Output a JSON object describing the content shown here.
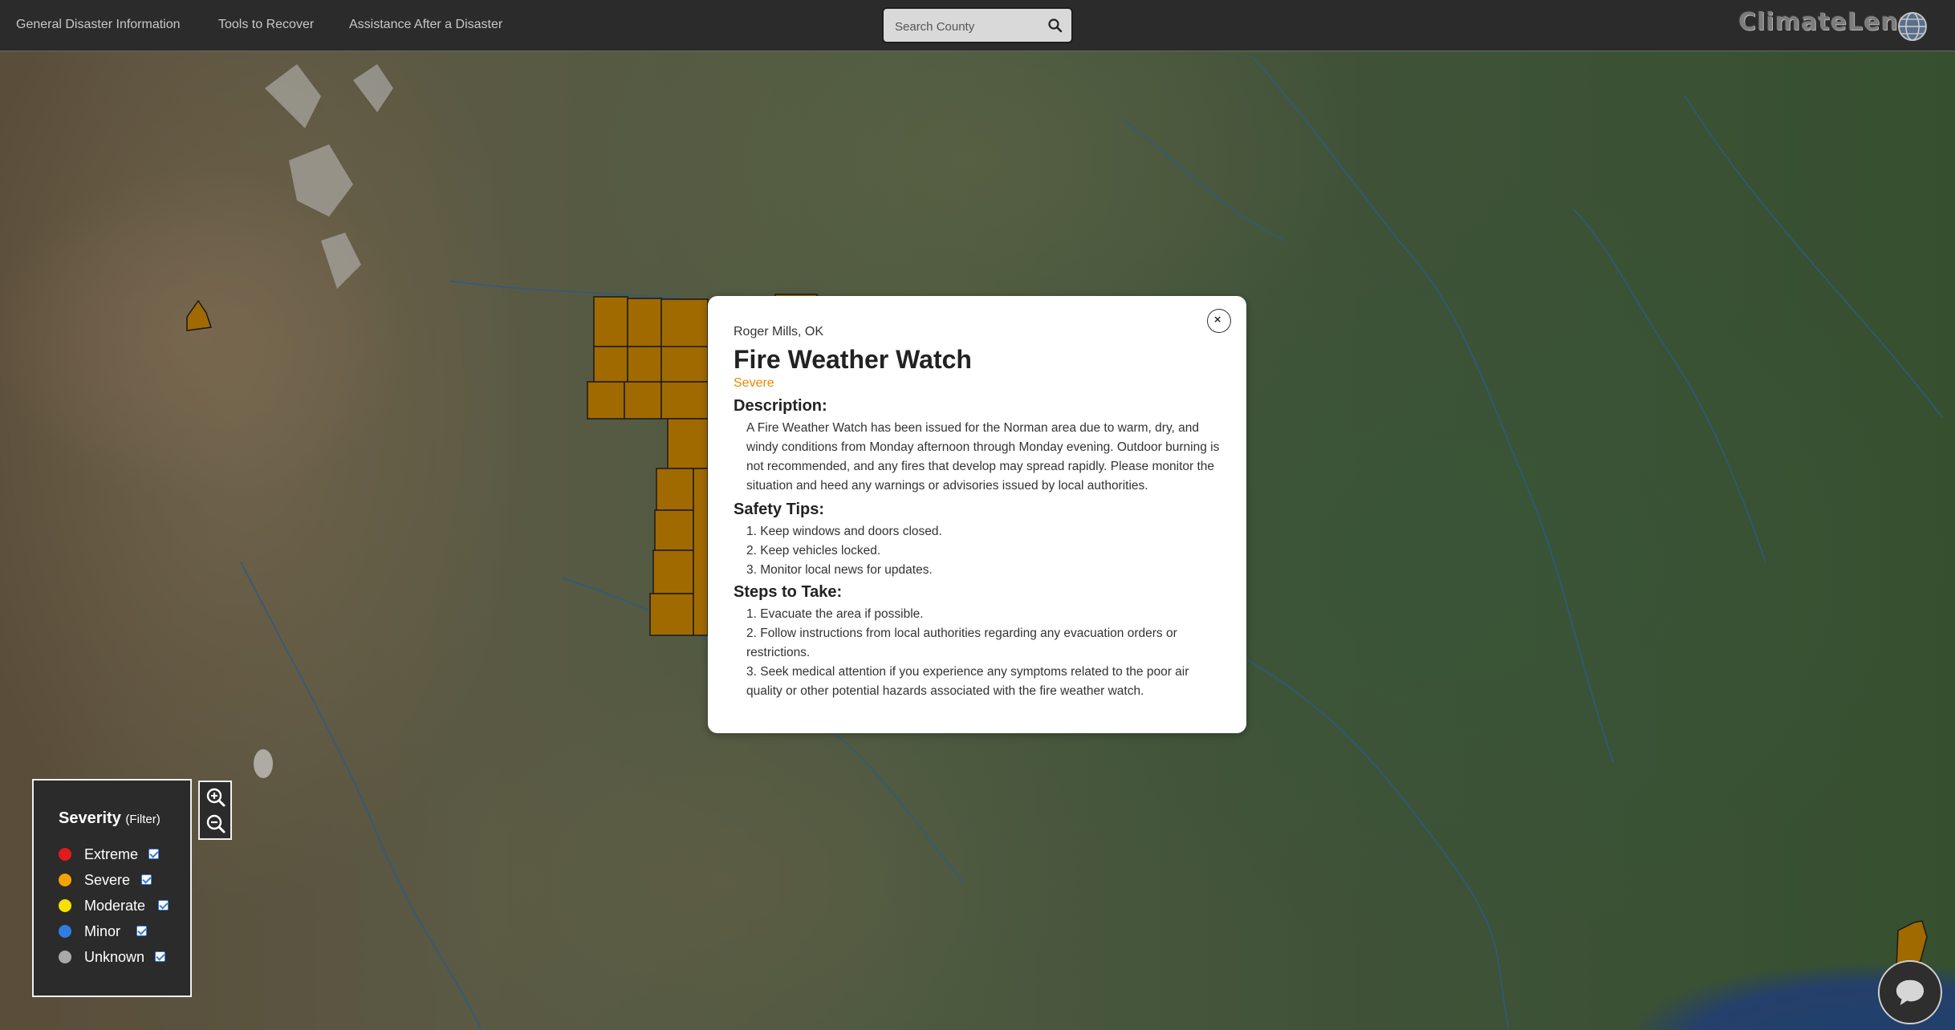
{
  "nav": {
    "links": [
      {
        "label": "General Disaster Information"
      },
      {
        "label": "Tools to Recover"
      },
      {
        "label": "Assistance After a Disaster"
      }
    ],
    "search": {
      "placeholder": "Search County",
      "value": ""
    },
    "logo": "ClimateLens"
  },
  "modal": {
    "location": "Roger Mills, OK",
    "title": "Fire Weather Watch",
    "severity": "Severe",
    "severity_color": "#e68a00",
    "description_heading": "Description:",
    "description": "A Fire Weather Watch has been issued for the Norman area due to warm, dry, and windy conditions from Monday afternoon through Monday evening. Outdoor burning is not recommended, and any fires that develop may spread rapidly. Please monitor the situation and heed any warnings or advisories issued by local authorities.",
    "safety_heading": "Safety Tips:",
    "safety_tips": [
      "1. Keep windows and doors closed.",
      "2. Keep vehicles locked.",
      "3. Monitor local news for updates."
    ],
    "steps_heading": "Steps to Take:",
    "steps": [
      "1. Evacuate the area if possible.",
      "2. Follow instructions from local authorities regarding any evacuation orders or restrictions.",
      "3. Seek medical attention if you experience any symptoms related to the poor air quality or other potential hazards associated with the fire weather watch."
    ]
  },
  "legend": {
    "title": "Severity",
    "filter_label": "(Filter)",
    "items": [
      {
        "label": "Extreme",
        "color": "#e31a1c",
        "checked": true
      },
      {
        "label": "Severe",
        "color": "#f5a300",
        "checked": true
      },
      {
        "label": "Moderate",
        "color": "#f5e100",
        "checked": true
      },
      {
        "label": "Minor",
        "color": "#2f7de1",
        "checked": true
      },
      {
        "label": "Unknown",
        "color": "#a9a9a9",
        "checked": true
      }
    ]
  },
  "map": {
    "alert_fill_color": "#a06a00"
  }
}
